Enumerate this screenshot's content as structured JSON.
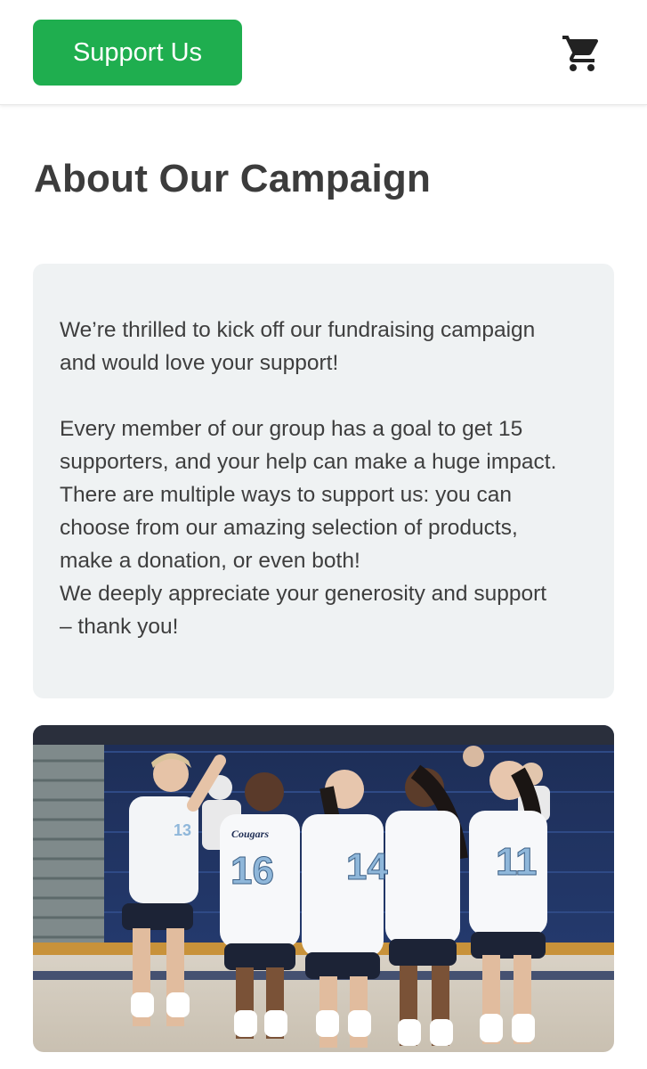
{
  "header": {
    "support_label": "Support Us",
    "cart_icon": "shopping-cart-icon",
    "accent_color": "#1fae4f"
  },
  "main": {
    "title": "About Our Campaign",
    "intro": {
      "line1": "We’re thrilled to kick off our fundraising campaign",
      "line2": "and would love your support!",
      "line3": "Every member of our group has a goal to get 15",
      "line4": "supporters, and your help can make a huge impact.",
      "line5": "There are multiple ways to support us: you can",
      "line6": "choose from our amazing selection of products,",
      "line7": "make a donation, or even both!",
      "line8": "We deeply appreciate your generosity and support",
      "line9": "– thank you!"
    },
    "photo": {
      "jersey_text": "Cougars",
      "numbers": [
        "16",
        "14",
        "11",
        "13"
      ]
    }
  }
}
